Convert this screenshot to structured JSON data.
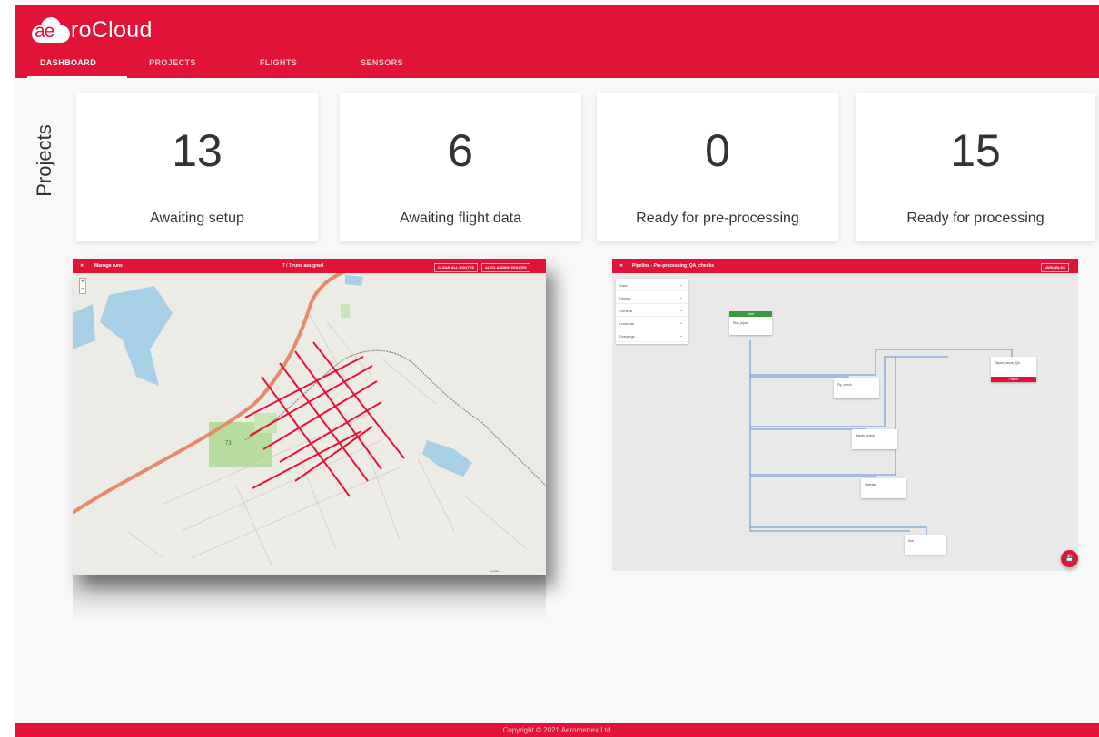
{
  "brand": {
    "logo_prefix": "ae",
    "logo_text": "roCloud"
  },
  "nav": [
    {
      "label": "DASHBOARD",
      "active": true
    },
    {
      "label": "PROJECTS"
    },
    {
      "label": "FLIGHTS"
    },
    {
      "label": "SENSORS"
    }
  ],
  "section_label": "Projects",
  "stats": [
    {
      "value": "13",
      "label": "Awaiting setup"
    },
    {
      "value": "6",
      "label": "Awaiting flight data"
    },
    {
      "value": "0",
      "label": "Ready for pre-processing"
    },
    {
      "value": "15",
      "label": "Ready for processing"
    }
  ],
  "map_panel": {
    "title": "Manage runs",
    "status": "7 / 7 runs assigned",
    "clear_button": "CLEAR ALL ROUTES",
    "assign_button": "AUTO-ASSIGN ROUTES",
    "zoom_in": "+",
    "zoom_out": "−",
    "park_label": "73"
  },
  "pipeline_panel": {
    "title": "Pipeline - Pre-processing_QA_checks",
    "variables_button": "VARIABLES",
    "steps": [
      "Data",
      "Delays",
      "General",
      "Lockouts",
      "Drawings"
    ],
    "nodes": {
      "start_header": "Start",
      "start": "Run_input",
      "error": "Report_Issue_QA",
      "error_footer": "Failure",
      "n1": "Fly_check",
      "n2": "Bands_check",
      "n3": "Overlap",
      "n4": "Sun"
    }
  },
  "footer": {
    "text": "Copyright © 2021 Aerometrex Ltd"
  },
  "colors": {
    "brand": "#e11438",
    "success": "#3b9b3b",
    "route": "#e11438",
    "connector": "#5b8fd6"
  }
}
